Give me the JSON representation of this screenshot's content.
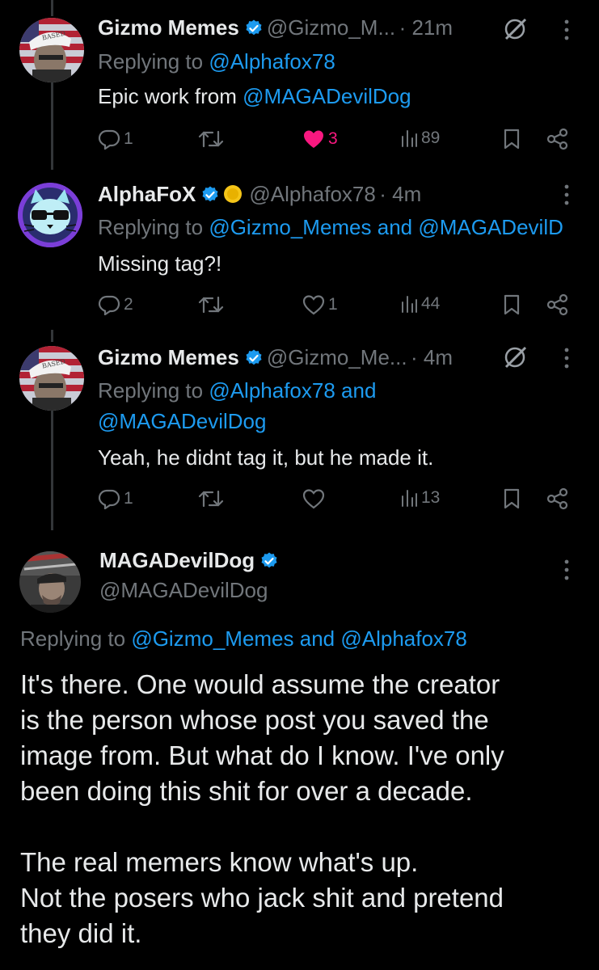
{
  "tweets": [
    {
      "name": "Gizmo Memes",
      "handle": "@Gizmo_M...",
      "time": "· 21m",
      "replying_prefix": "Replying to ",
      "replying_to": "@Alphafox78",
      "text_prefix": "Epic work from ",
      "text_mention": "@MAGADevilDog",
      "replies": "1",
      "likes": "3",
      "views": "89"
    },
    {
      "name": "AlphaFoX",
      "handle": "@Alphafox78",
      "time": "· 4m",
      "replying_prefix": "Replying to ",
      "replying_to": "@Gizmo_Memes and @MAGADevilD",
      "text": "Missing tag?!",
      "replies": "2",
      "likes": "1",
      "views": "44"
    },
    {
      "name": "Gizmo Memes",
      "handle": "@Gizmo_Me...",
      "time": "· 4m",
      "replying_prefix": "Replying to ",
      "replying_to_1": "@Alphafox78 and",
      "replying_to_2": "@MAGADevilDog",
      "text": "Yeah, he didnt tag it, but he made it.",
      "replies": "1",
      "views": "13"
    }
  ],
  "main_tweet": {
    "name": "MAGADevilDog",
    "handle": "@MAGADevilDog",
    "replying_prefix": "Replying to ",
    "replying_to": "@Gizmo_Memes and @Alphafox78",
    "body_lines_1": [
      "It's there.  One would assume the creator",
      "is the person whose post you saved the",
      "image from.  But what do I know.  I've only",
      "been doing this shit for over a decade."
    ],
    "body_lines_2": [
      "The real memers know what's up.",
      "Not the posers who jack shit and pretend",
      "they did it."
    ]
  },
  "avatar_text": {
    "gizmo_hat": "BASED"
  },
  "colors": {
    "background": "#000000",
    "text": "#e7e9ea",
    "secondary": "#71767b",
    "accent": "#1d9bf0",
    "like": "#f91880"
  },
  "icons": [
    "reply-icon",
    "retweet-icon",
    "heart-icon",
    "views-icon",
    "bookmark-icon",
    "share-icon",
    "more-icon",
    "verified-icon",
    "grok-icon",
    "coin-icon"
  ]
}
